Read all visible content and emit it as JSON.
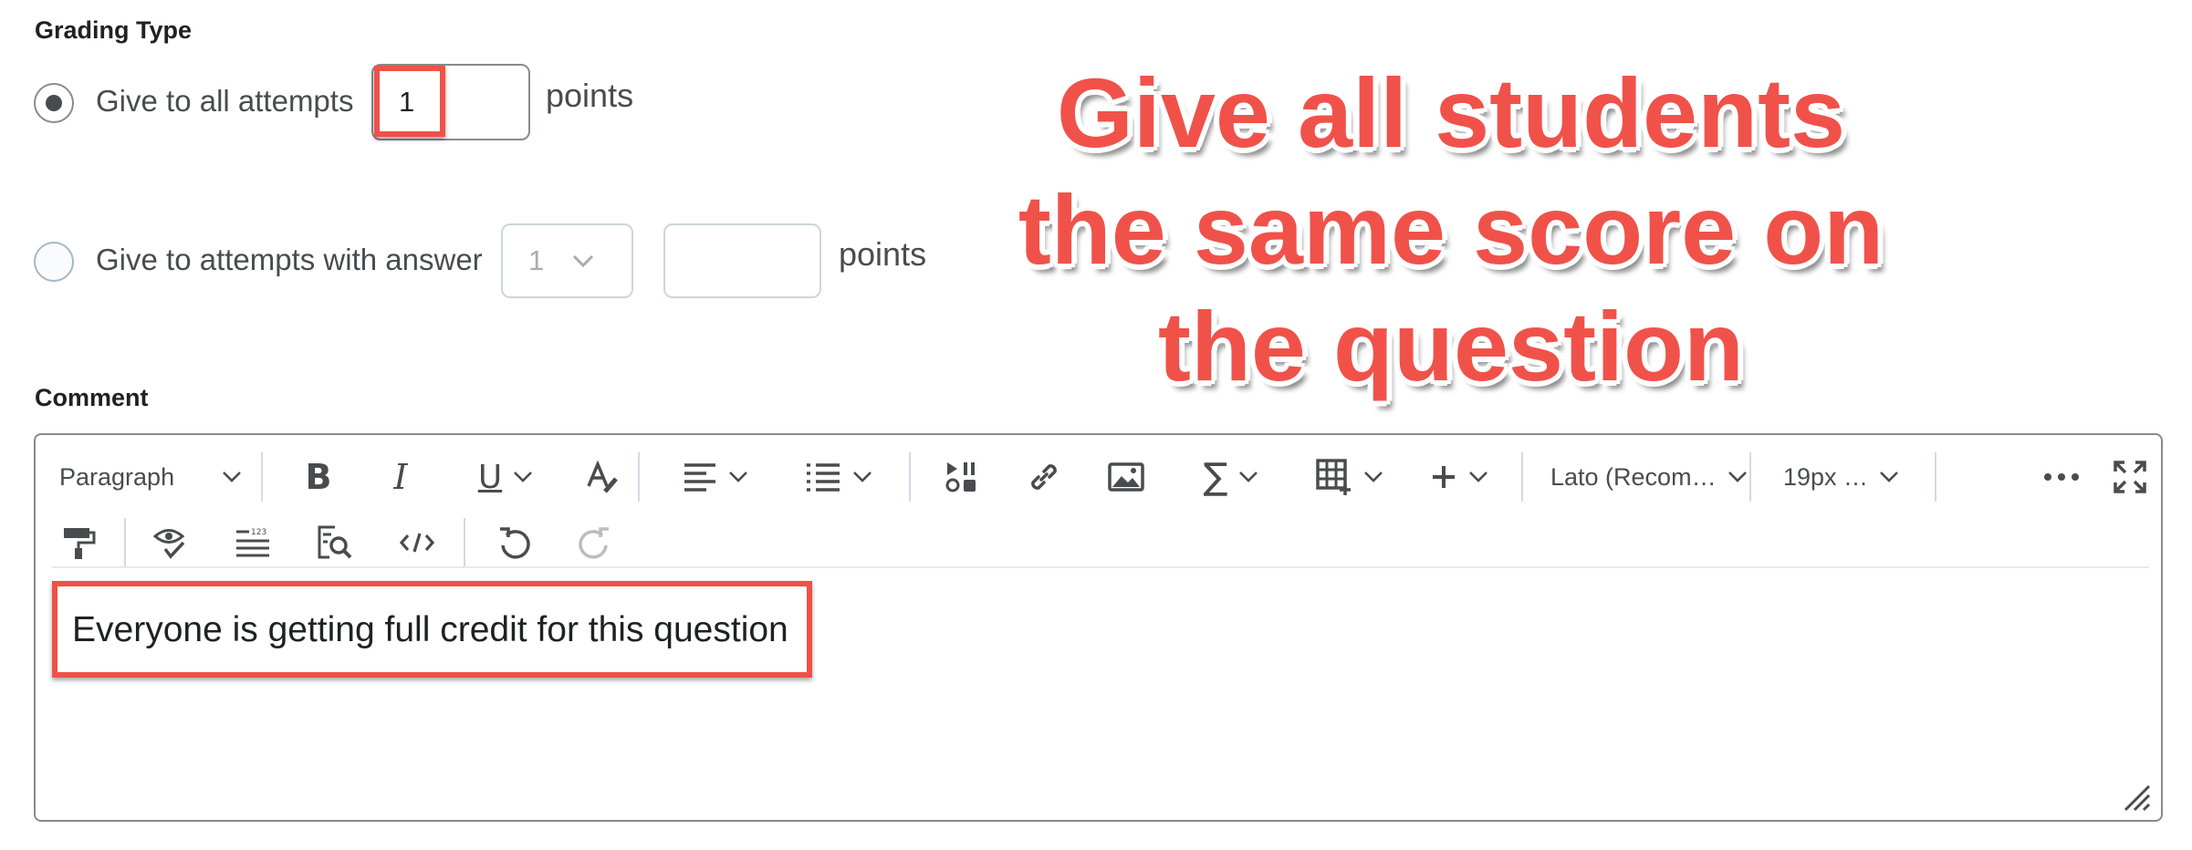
{
  "grading": {
    "section_label": "Grading Type",
    "option_all": {
      "label": "Give to all attempts",
      "points_value": "1",
      "points_unit": "points",
      "selected": true
    },
    "option_answer": {
      "label": "Give to attempts with answer",
      "answer_select": "1",
      "points_value": "",
      "points_unit": "points",
      "selected": false
    }
  },
  "comment": {
    "section_label": "Comment",
    "toolbar": {
      "block_format": "Paragraph",
      "font_family": "Lato (Recom…",
      "font_size": "19px …",
      "icons": [
        "bold-icon",
        "italic-icon",
        "underline-icon",
        "text-color-icon",
        "align-icon",
        "list-icon",
        "media-icon",
        "link-icon",
        "image-icon",
        "equation-icon",
        "table-icon",
        "insert-icon",
        "more-icon",
        "fullscreen-icon",
        "format-painter-icon",
        "accessibility-check-icon",
        "line-numbers-icon",
        "find-replace-icon",
        "source-code-icon",
        "undo-icon",
        "redo-icon"
      ]
    },
    "body_text": "Everyone is getting full credit for this question"
  },
  "annotation": {
    "line1": "Give all students",
    "line2": "the same score on",
    "line3": "the question"
  },
  "colors": {
    "callout_red": "#ef5147",
    "text_dark": "#494c4e",
    "border_gray": "#868c8f",
    "toolbar_sep": "#d3d9e3"
  }
}
